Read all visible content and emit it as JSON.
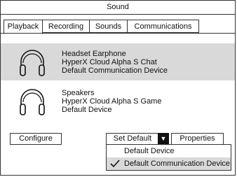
{
  "window": {
    "title": "Sound"
  },
  "tabs": [
    {
      "label": "Playback",
      "active": true
    },
    {
      "label": "Recording",
      "active": false
    },
    {
      "label": "Sounds",
      "active": false
    },
    {
      "label": "Communications",
      "active": false
    }
  ],
  "devices": [
    {
      "icon": "headphones-icon",
      "name": "Headset Earphone",
      "model": "HyperX Cloud Alpha S Chat",
      "status": "Default Communication Device",
      "selected": true
    },
    {
      "icon": "headphones-icon",
      "name": "Speakers",
      "model": "HyperX Cloud Alpha S Game",
      "status": "Default Device",
      "selected": false
    }
  ],
  "buttons": {
    "configure": "Configure",
    "set_default": "Set Default",
    "properties": "Properties"
  },
  "dropdown_menu": [
    {
      "label": "Default Device",
      "checked": false
    },
    {
      "label": "Default Communication Device",
      "checked": true
    }
  ],
  "colors": {
    "selection": "#d9d9d9",
    "border": "#333333"
  }
}
